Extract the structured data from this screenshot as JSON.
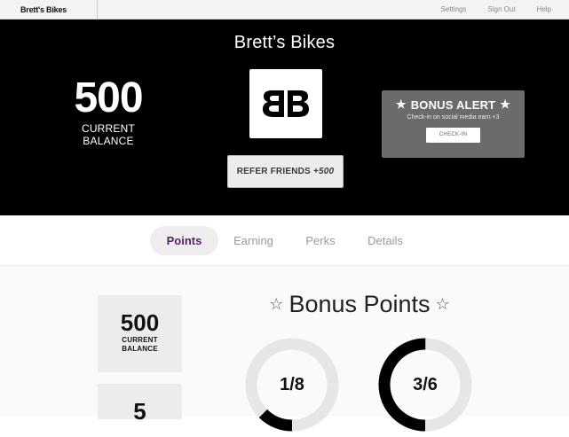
{
  "topbar": {
    "brand": "Brett's Bikes",
    "links": [
      "Settings",
      "Sign Out",
      "Help"
    ]
  },
  "hero": {
    "title": "Brett’s Bikes",
    "balance_value": "500",
    "balance_label_line1": "CURRENT",
    "balance_label_line2": "BALANCE",
    "refer_label": "REFER FRIENDS",
    "refer_bonus": "+500",
    "bonus": {
      "title": "BONUS ALERT",
      "description": "Check-in on social media earn +3",
      "button_label": "CHECK-IN"
    }
  },
  "tabs": [
    {
      "label": "Points",
      "active": true
    },
    {
      "label": "Earning",
      "active": false
    },
    {
      "label": "Perks",
      "active": false
    },
    {
      "label": "Details",
      "active": false
    }
  ],
  "stats": [
    {
      "value": "500",
      "label_line1": "CURRENT",
      "label_line2": "BALANCE"
    },
    {
      "value": "5",
      "label_line1": "",
      "label_line2": ""
    }
  ],
  "bonus_points": {
    "heading": "Bonus Points",
    "gauges": [
      {
        "label": "1/8",
        "progress": 0.125
      },
      {
        "label": "3/6",
        "progress": 0.5
      }
    ]
  },
  "colors": {
    "hero_bg": "#000000",
    "accent_purple": "#5a1f6b",
    "bonus_card": "#6b6b6b",
    "gauge_track": "#e6e6e6",
    "gauge_fill": "#000000"
  },
  "icons": [
    "star-icon",
    "star-outline-icon",
    "logo-bb"
  ]
}
